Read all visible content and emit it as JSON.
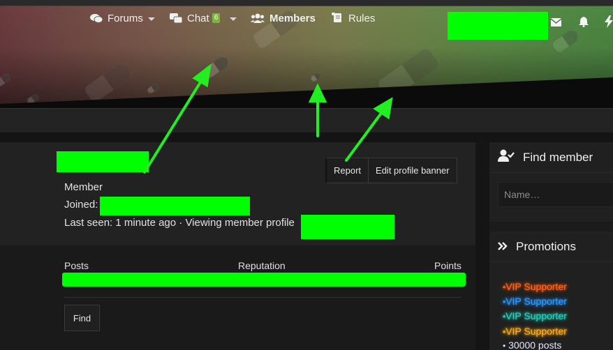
{
  "colors": {
    "accent_green": "#00ff00",
    "badge_green": "#7cb342",
    "vip_red": "#ff6a2a",
    "vip_blue": "#33a0ff",
    "vip_teal": "#2dd4bf",
    "vip_gold": "#ffb020"
  },
  "nav": {
    "forums": {
      "label": "Forums",
      "icon": "comments-icon"
    },
    "chat": {
      "label": "Chat",
      "badge": "6",
      "icon": "chat-icon"
    },
    "members": {
      "label": "Members",
      "icon": "users-icon"
    },
    "rules": {
      "label": "Rules",
      "icon": "scroll-icon"
    }
  },
  "header_icons": [
    "envelope-icon",
    "bell-icon",
    "bolt-icon"
  ],
  "profile": {
    "role": "Member",
    "joined_label": "Joined:",
    "last_seen": "Last seen: 1 minute ago · Viewing member profile",
    "buttons": {
      "report": "Report",
      "edit_banner": "Edit profile banner"
    },
    "stats": {
      "posts": "Posts",
      "reputation": "Reputation",
      "points": "Points"
    },
    "find": "Find"
  },
  "sidebar": {
    "find_member": {
      "title": "Find member",
      "icon": "user-check-icon",
      "placeholder": "Name…"
    },
    "promotions": {
      "title": "Promotions",
      "icon": "double-chevron-icon",
      "items": [
        "VIP Supporter",
        "VIP Supporter",
        "VIP Supporter",
        "VIP Supporter",
        "30000 posts"
      ]
    }
  }
}
